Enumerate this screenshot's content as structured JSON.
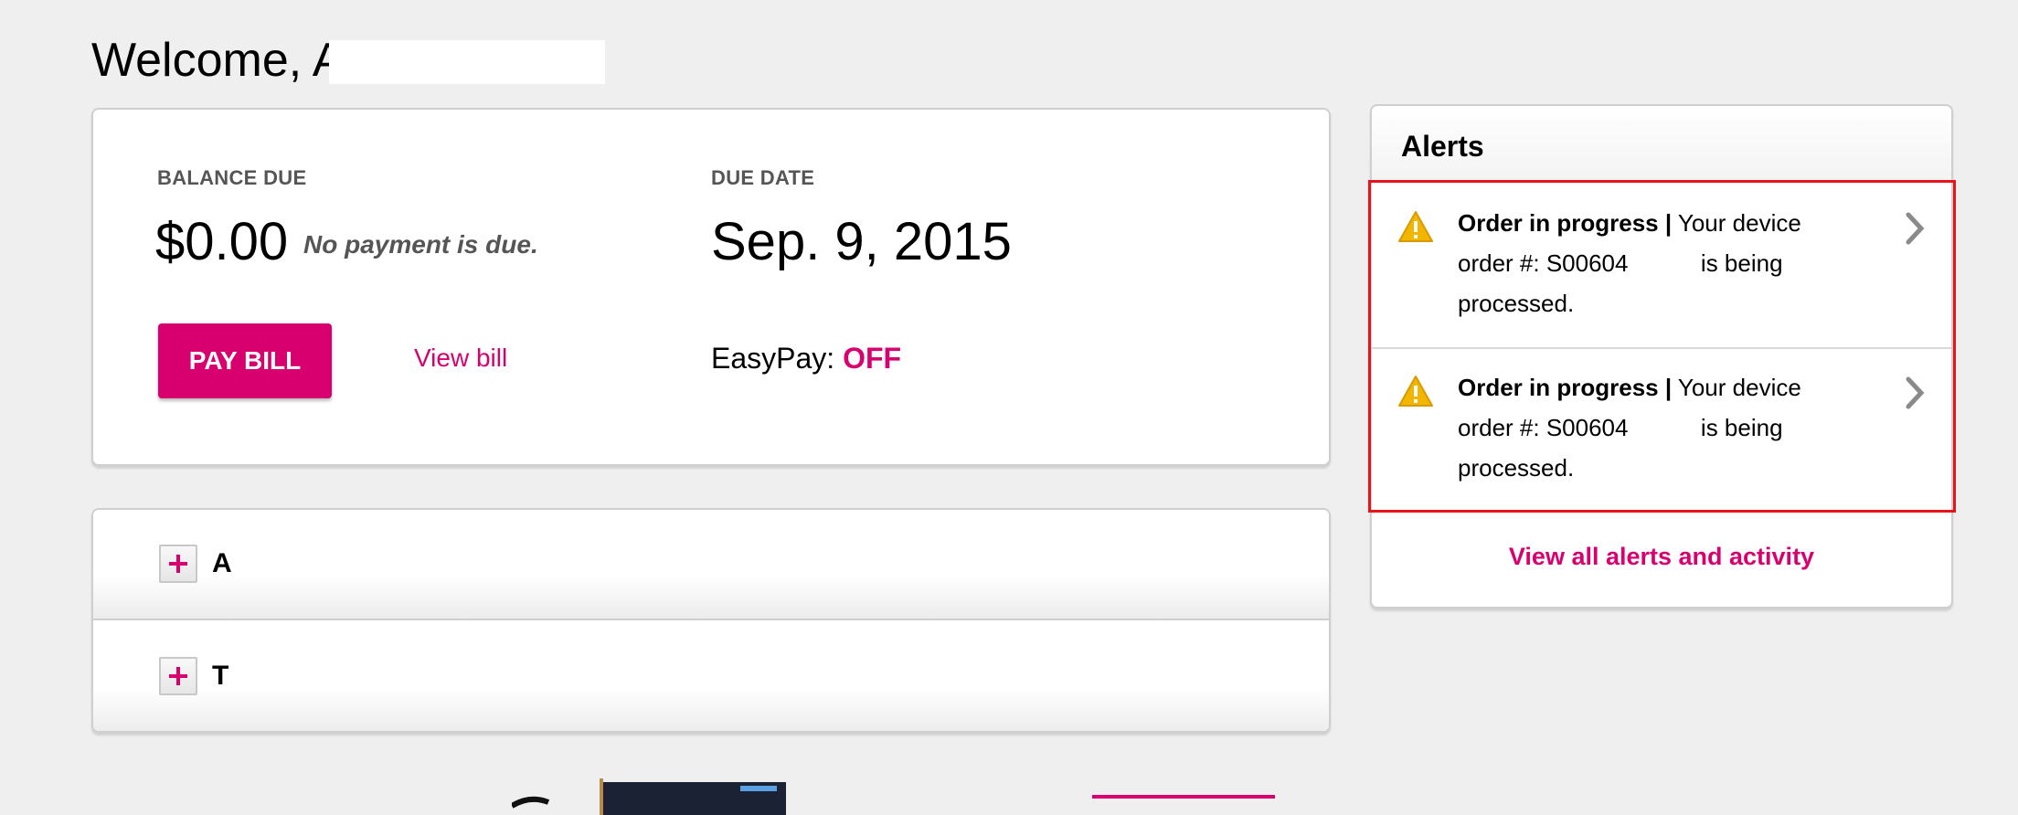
{
  "welcome": {
    "text": "Welcome, A"
  },
  "balance": {
    "balance_label": "BALANCE DUE",
    "amount": "$0.00",
    "no_payment_note": "No payment is due.",
    "due_date_label": "DUE DATE",
    "due_date": "Sep. 9, 2015",
    "pay_button": "PAY BILL",
    "view_bill": "View bill",
    "easypay_label": "EasyPay:",
    "easypay_status": "OFF"
  },
  "accordion": {
    "items": [
      {
        "label": "A"
      },
      {
        "label": "T"
      }
    ]
  },
  "alerts": {
    "title": "Alerts",
    "items": [
      {
        "heading": "Order in progress |",
        "line1_rest": "Your device",
        "line2": "order #: S00604           is being",
        "line3": "processed."
      },
      {
        "heading": "Order in progress |",
        "line1_rest": "Your device",
        "line2": "order #: S00604           is being",
        "line3": "processed."
      }
    ],
    "view_all": "View all alerts and activity"
  },
  "colors": {
    "brand_magenta": "#d8006f",
    "highlight_red": "#e8141b",
    "warning_yellow": "#f2b500"
  },
  "icons": {
    "warning": "warning-triangle-icon",
    "chevron": "chevron-right-icon",
    "expand": "plus-icon"
  }
}
